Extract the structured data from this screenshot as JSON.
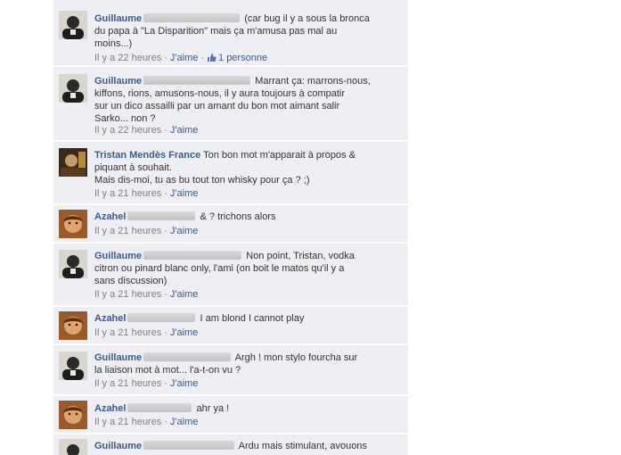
{
  "comments": [
    {
      "author": "Guillaume",
      "text": " (car bug il y a sous la bronca\ndu papa à \"La Disparition\" mais ça m'amusa pas mal au\nmoins...)",
      "time": "Il y a 22 heures",
      "like": "J'aime",
      "likes_count": "1 personne",
      "avatar": "guillaume-avatar"
    },
    {
      "author": "Guillaume",
      "text": " Marrant ça: marrons-nous,\nkiffons, rions, amusons-nous, il y aura toujours à compatir\nsur un dico assailli par un amant du bon mot aimant salir\nSarko... non ?",
      "time": "Il y a 22 heures",
      "like": "J'aime",
      "avatar": "guillaume-avatar"
    },
    {
      "author": "Tristan Mendès France",
      "text": " Ton bon mot m'apparait à propos &\npiquant à souhait.\nMais dis-moi, tu as bu tout ton whisky pour ça ? ;)",
      "time": "Il y a 21 heures",
      "like": "J'aime",
      "avatar": "tristan-avatar"
    },
    {
      "author": "Azahel",
      "text": " & ? trichons alors",
      "time": "Il y a 21 heures",
      "like": "J'aime",
      "avatar": "azahel-avatar"
    },
    {
      "author": "Guillaume",
      "text": " Non point, Tristan, vodka\ncitron ou pinard blanc only, l'ami (on boit le matos qu'il y a\nsans discussion)",
      "time": "Il y a 21 heures",
      "like": "J'aime",
      "avatar": "guillaume-avatar"
    },
    {
      "author": "Azahel",
      "text": " I am blond I cannot play",
      "time": "Il y a 21 heures",
      "like": "J'aime",
      "avatar": "azahel-avatar"
    },
    {
      "author": "Guillaume",
      "text": " Argh ! mon stylo fourcha sur\nla liaison mot à mot... l'a-t-on vu ?",
      "time": "Il y a 21 heures",
      "like": "J'aime",
      "avatar": "guillaume-avatar"
    },
    {
      "author": "Azahel",
      "text": " ahr ya !",
      "time": "Il y a 21 heures",
      "like": "J'aime",
      "avatar": "azahel-avatar"
    },
    {
      "author": "Guillaume",
      "text": " Ardu mais stimulant, avouons",
      "time": "",
      "like": "",
      "avatar": "guillaume-avatar"
    }
  ],
  "colors": {
    "link": "#3b5998",
    "comment_bg": "#edeff4",
    "meta": "#808080",
    "redaction": "#cccccc"
  }
}
